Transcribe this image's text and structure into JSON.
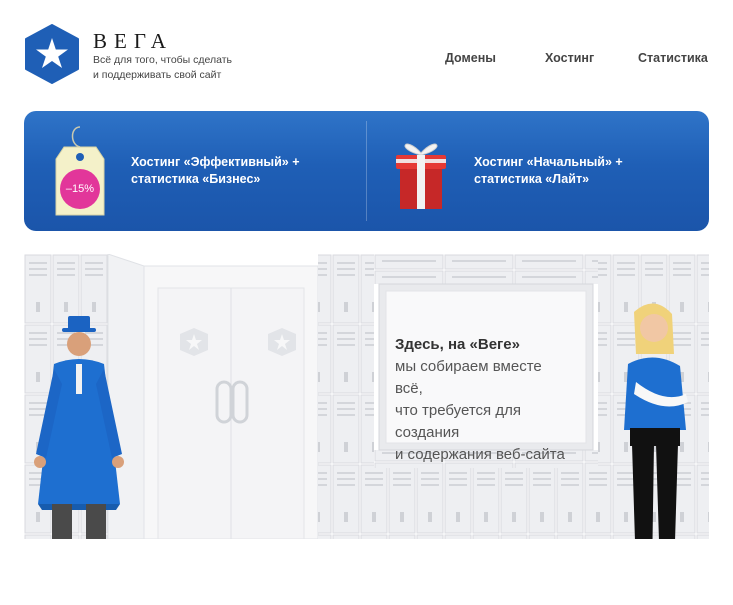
{
  "header": {
    "brand": "ВЕГА",
    "tagline_line1": "Всё для того, чтобы сделать",
    "tagline_line2": "и поддерживать свой сайт",
    "logo_icon": "star-hexagon-icon"
  },
  "nav": {
    "domains": "Домены",
    "hosting": "Хостинг",
    "stats": "Статистика"
  },
  "promo": {
    "offer1_line1": "Хостинг «Эффективный» +",
    "offer1_line2": "статистика «Бизнес»",
    "discount": "–15%",
    "offer2_line1": "Хостинг «Начальный» +",
    "offer2_line2": "статистика «Лайт»"
  },
  "hero": {
    "lead": "Здесь, на «Веге»",
    "line2": "мы собираем вместе всё,",
    "line3": "что требуется для создания",
    "line4": "и содержания веб-сайта"
  },
  "colors": {
    "brand_blue": "#1f5fb6",
    "discount_pink": "#e2369a"
  }
}
